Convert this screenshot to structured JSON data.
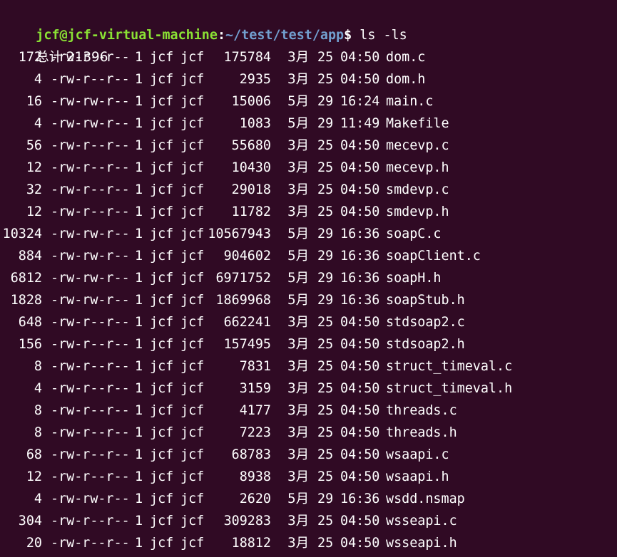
{
  "prompt": {
    "user_host": "jcf@jcf-virtual-machine",
    "separator": ":",
    "path": "~/test/test/app",
    "symbol": "$",
    "command": " ls -ls"
  },
  "total_line": "总计 21396",
  "files": [
    {
      "blocks": "172",
      "perms": "-rw-r--r--",
      "links": "1",
      "user": "jcf",
      "group": "jcf",
      "size": "175784",
      "month": "3月",
      "day": "25",
      "time": "04:50",
      "name": "dom.c"
    },
    {
      "blocks": "4",
      "perms": "-rw-r--r--",
      "links": "1",
      "user": "jcf",
      "group": "jcf",
      "size": "2935",
      "month": "3月",
      "day": "25",
      "time": "04:50",
      "name": "dom.h"
    },
    {
      "blocks": "16",
      "perms": "-rw-rw-r--",
      "links": "1",
      "user": "jcf",
      "group": "jcf",
      "size": "15006",
      "month": "5月",
      "day": "29",
      "time": "16:24",
      "name": "main.c"
    },
    {
      "blocks": "4",
      "perms": "-rw-rw-r--",
      "links": "1",
      "user": "jcf",
      "group": "jcf",
      "size": "1083",
      "month": "5月",
      "day": "29",
      "time": "11:49",
      "name": "Makefile"
    },
    {
      "blocks": "56",
      "perms": "-rw-r--r--",
      "links": "1",
      "user": "jcf",
      "group": "jcf",
      "size": "55680",
      "month": "3月",
      "day": "25",
      "time": "04:50",
      "name": "mecevp.c"
    },
    {
      "blocks": "12",
      "perms": "-rw-r--r--",
      "links": "1",
      "user": "jcf",
      "group": "jcf",
      "size": "10430",
      "month": "3月",
      "day": "25",
      "time": "04:50",
      "name": "mecevp.h"
    },
    {
      "blocks": "32",
      "perms": "-rw-r--r--",
      "links": "1",
      "user": "jcf",
      "group": "jcf",
      "size": "29018",
      "month": "3月",
      "day": "25",
      "time": "04:50",
      "name": "smdevp.c"
    },
    {
      "blocks": "12",
      "perms": "-rw-r--r--",
      "links": "1",
      "user": "jcf",
      "group": "jcf",
      "size": "11782",
      "month": "3月",
      "day": "25",
      "time": "04:50",
      "name": "smdevp.h"
    },
    {
      "blocks": "10324",
      "perms": "-rw-rw-r--",
      "links": "1",
      "user": "jcf",
      "group": "jcf",
      "size": "10567943",
      "month": "5月",
      "day": "29",
      "time": "16:36",
      "name": "soapC.c"
    },
    {
      "blocks": "884",
      "perms": "-rw-rw-r--",
      "links": "1",
      "user": "jcf",
      "group": "jcf",
      "size": "904602",
      "month": "5月",
      "day": "29",
      "time": "16:36",
      "name": "soapClient.c"
    },
    {
      "blocks": "6812",
      "perms": "-rw-rw-r--",
      "links": "1",
      "user": "jcf",
      "group": "jcf",
      "size": "6971752",
      "month": "5月",
      "day": "29",
      "time": "16:36",
      "name": "soapH.h"
    },
    {
      "blocks": "1828",
      "perms": "-rw-rw-r--",
      "links": "1",
      "user": "jcf",
      "group": "jcf",
      "size": "1869968",
      "month": "5月",
      "day": "29",
      "time": "16:36",
      "name": "soapStub.h"
    },
    {
      "blocks": "648",
      "perms": "-rw-r--r--",
      "links": "1",
      "user": "jcf",
      "group": "jcf",
      "size": "662241",
      "month": "3月",
      "day": "25",
      "time": "04:50",
      "name": "stdsoap2.c"
    },
    {
      "blocks": "156",
      "perms": "-rw-r--r--",
      "links": "1",
      "user": "jcf",
      "group": "jcf",
      "size": "157495",
      "month": "3月",
      "day": "25",
      "time": "04:50",
      "name": "stdsoap2.h"
    },
    {
      "blocks": "8",
      "perms": "-rw-r--r--",
      "links": "1",
      "user": "jcf",
      "group": "jcf",
      "size": "7831",
      "month": "3月",
      "day": "25",
      "time": "04:50",
      "name": "struct_timeval.c"
    },
    {
      "blocks": "4",
      "perms": "-rw-r--r--",
      "links": "1",
      "user": "jcf",
      "group": "jcf",
      "size": "3159",
      "month": "3月",
      "day": "25",
      "time": "04:50",
      "name": "struct_timeval.h"
    },
    {
      "blocks": "8",
      "perms": "-rw-r--r--",
      "links": "1",
      "user": "jcf",
      "group": "jcf",
      "size": "4177",
      "month": "3月",
      "day": "25",
      "time": "04:50",
      "name": "threads.c"
    },
    {
      "blocks": "8",
      "perms": "-rw-r--r--",
      "links": "1",
      "user": "jcf",
      "group": "jcf",
      "size": "7223",
      "month": "3月",
      "day": "25",
      "time": "04:50",
      "name": "threads.h"
    },
    {
      "blocks": "68",
      "perms": "-rw-r--r--",
      "links": "1",
      "user": "jcf",
      "group": "jcf",
      "size": "68783",
      "month": "3月",
      "day": "25",
      "time": "04:50",
      "name": "wsaapi.c"
    },
    {
      "blocks": "12",
      "perms": "-rw-r--r--",
      "links": "1",
      "user": "jcf",
      "group": "jcf",
      "size": "8938",
      "month": "3月",
      "day": "25",
      "time": "04:50",
      "name": "wsaapi.h"
    },
    {
      "blocks": "4",
      "perms": "-rw-rw-r--",
      "links": "1",
      "user": "jcf",
      "group": "jcf",
      "size": "2620",
      "month": "5月",
      "day": "29",
      "time": "16:36",
      "name": "wsdd.nsmap"
    },
    {
      "blocks": "304",
      "perms": "-rw-r--r--",
      "links": "1",
      "user": "jcf",
      "group": "jcf",
      "size": "309283",
      "month": "3月",
      "day": "25",
      "time": "04:50",
      "name": "wsseapi.c"
    },
    {
      "blocks": "20",
      "perms": "-rw-r--r--",
      "links": "1",
      "user": "jcf",
      "group": "jcf",
      "size": "18812",
      "month": "3月",
      "day": "25",
      "time": "04:50",
      "name": "wsseapi.h"
    }
  ],
  "colors": {
    "background": "#300a24",
    "user_host": "#8ae234",
    "path": "#729fcf",
    "text": "#ffffff"
  }
}
